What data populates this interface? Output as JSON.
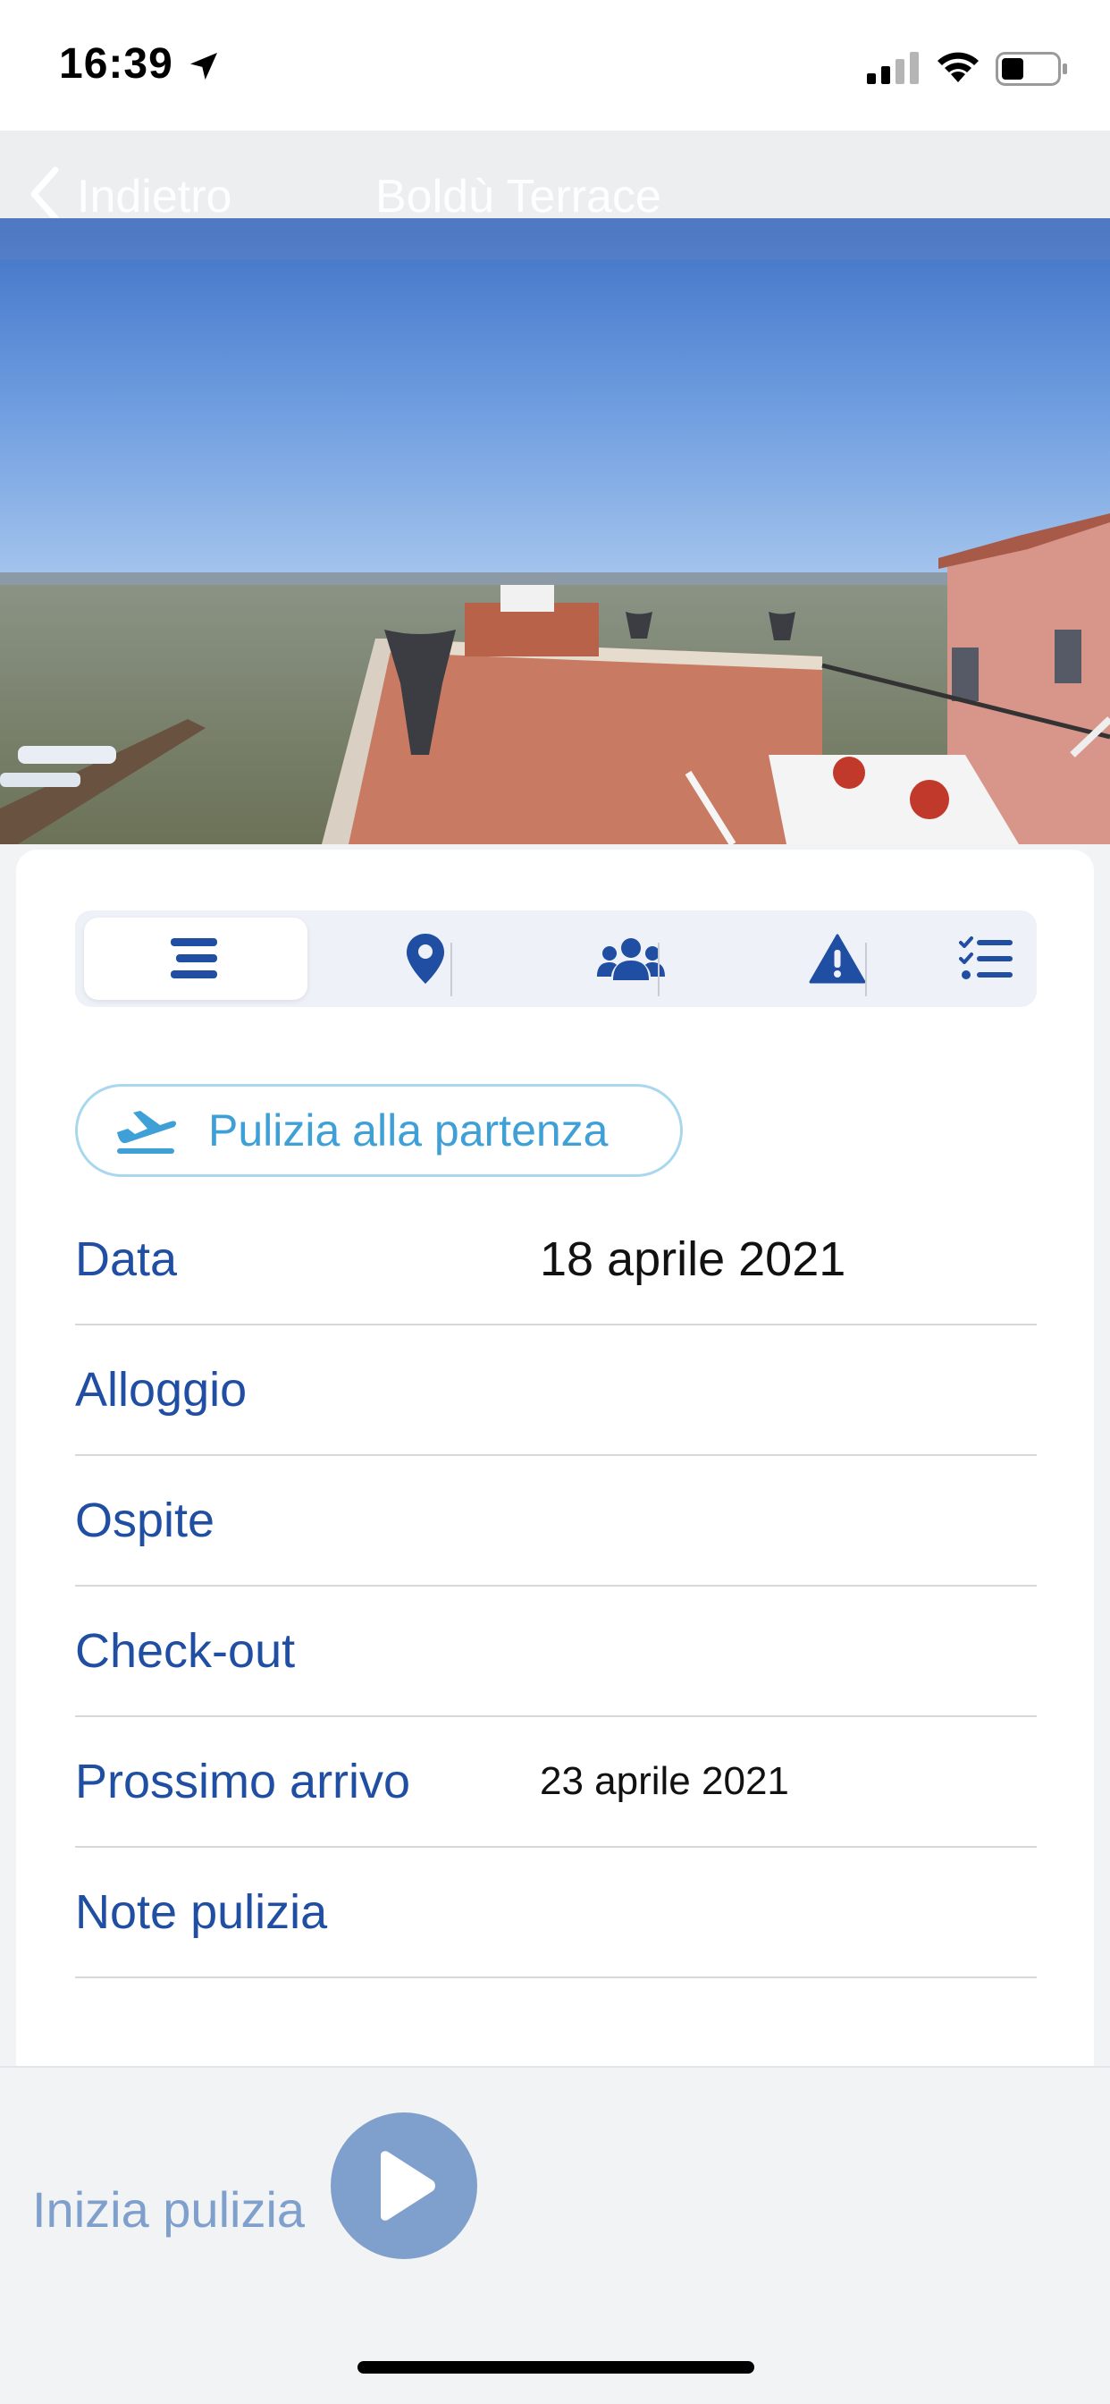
{
  "status_bar": {
    "time": "16:39"
  },
  "nav": {
    "back_label": "Indietro",
    "title": "Boldù Terrace"
  },
  "tabs": [
    {
      "icon": "list-lines-icon",
      "active": true
    },
    {
      "icon": "location-pin-icon",
      "active": false
    },
    {
      "icon": "users-group-icon",
      "active": false
    },
    {
      "icon": "warning-icon",
      "active": false
    },
    {
      "icon": "checklist-icon",
      "active": false
    }
  ],
  "cleaning_type": {
    "label": "Pulizia alla partenza",
    "icon": "airplane-departure-icon"
  },
  "details": {
    "data": {
      "label": "Data",
      "value": "18 aprile 2021"
    },
    "alloggio": {
      "label": "Alloggio",
      "value": ""
    },
    "ospite": {
      "label": "Ospite",
      "value": ""
    },
    "checkout": {
      "label": "Check-out",
      "value": ""
    },
    "prossimo_arrivo": {
      "label": "Prossimo arrivo",
      "value": "23 aprile 2021"
    },
    "note_pulizia": {
      "label": "Note pulizia",
      "value": ""
    }
  },
  "bottom": {
    "start_label": "Inizia pulizia"
  },
  "colors": {
    "primary": "#1f4ea3",
    "accent": "#3ea0d6",
    "muted_button": "#7f9fcc"
  }
}
